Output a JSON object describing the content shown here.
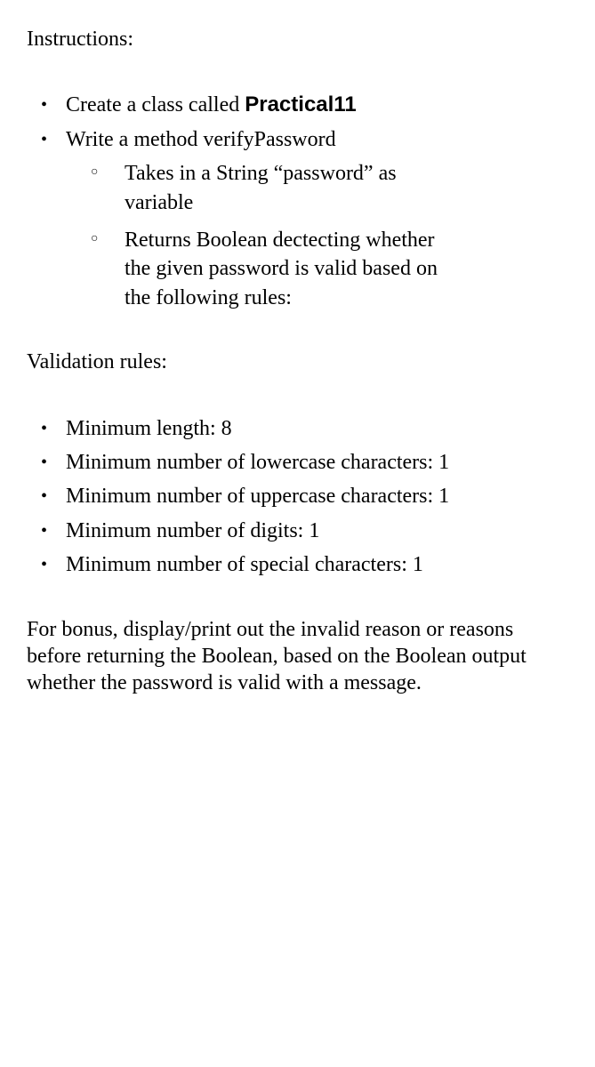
{
  "heading1": "Instructions:",
  "list1": {
    "item1_prefix": "Create a class called ",
    "item1_bold": "Practical11",
    "item2": "Write a method verifyPassword",
    "sub": {
      "item1": "Takes in a String “password” as variable",
      "item2": "Returns Boolean dectecting whether the given password is valid based on the following rules:"
    }
  },
  "heading2": "Validation rules:",
  "list2": {
    "item1": "Minimum length: 8",
    "item2": "Minimum number of lowercase characters: 1",
    "item3": "Minimum number of uppercase characters: 1",
    "item4": "Minimum number of digits: 1",
    "item5": "Minimum number of special characters: 1"
  },
  "bonus": "For bonus, display/print out the invalid reason or reasons before returning the Boolean, based on the Boolean output whether the password is valid with a message."
}
